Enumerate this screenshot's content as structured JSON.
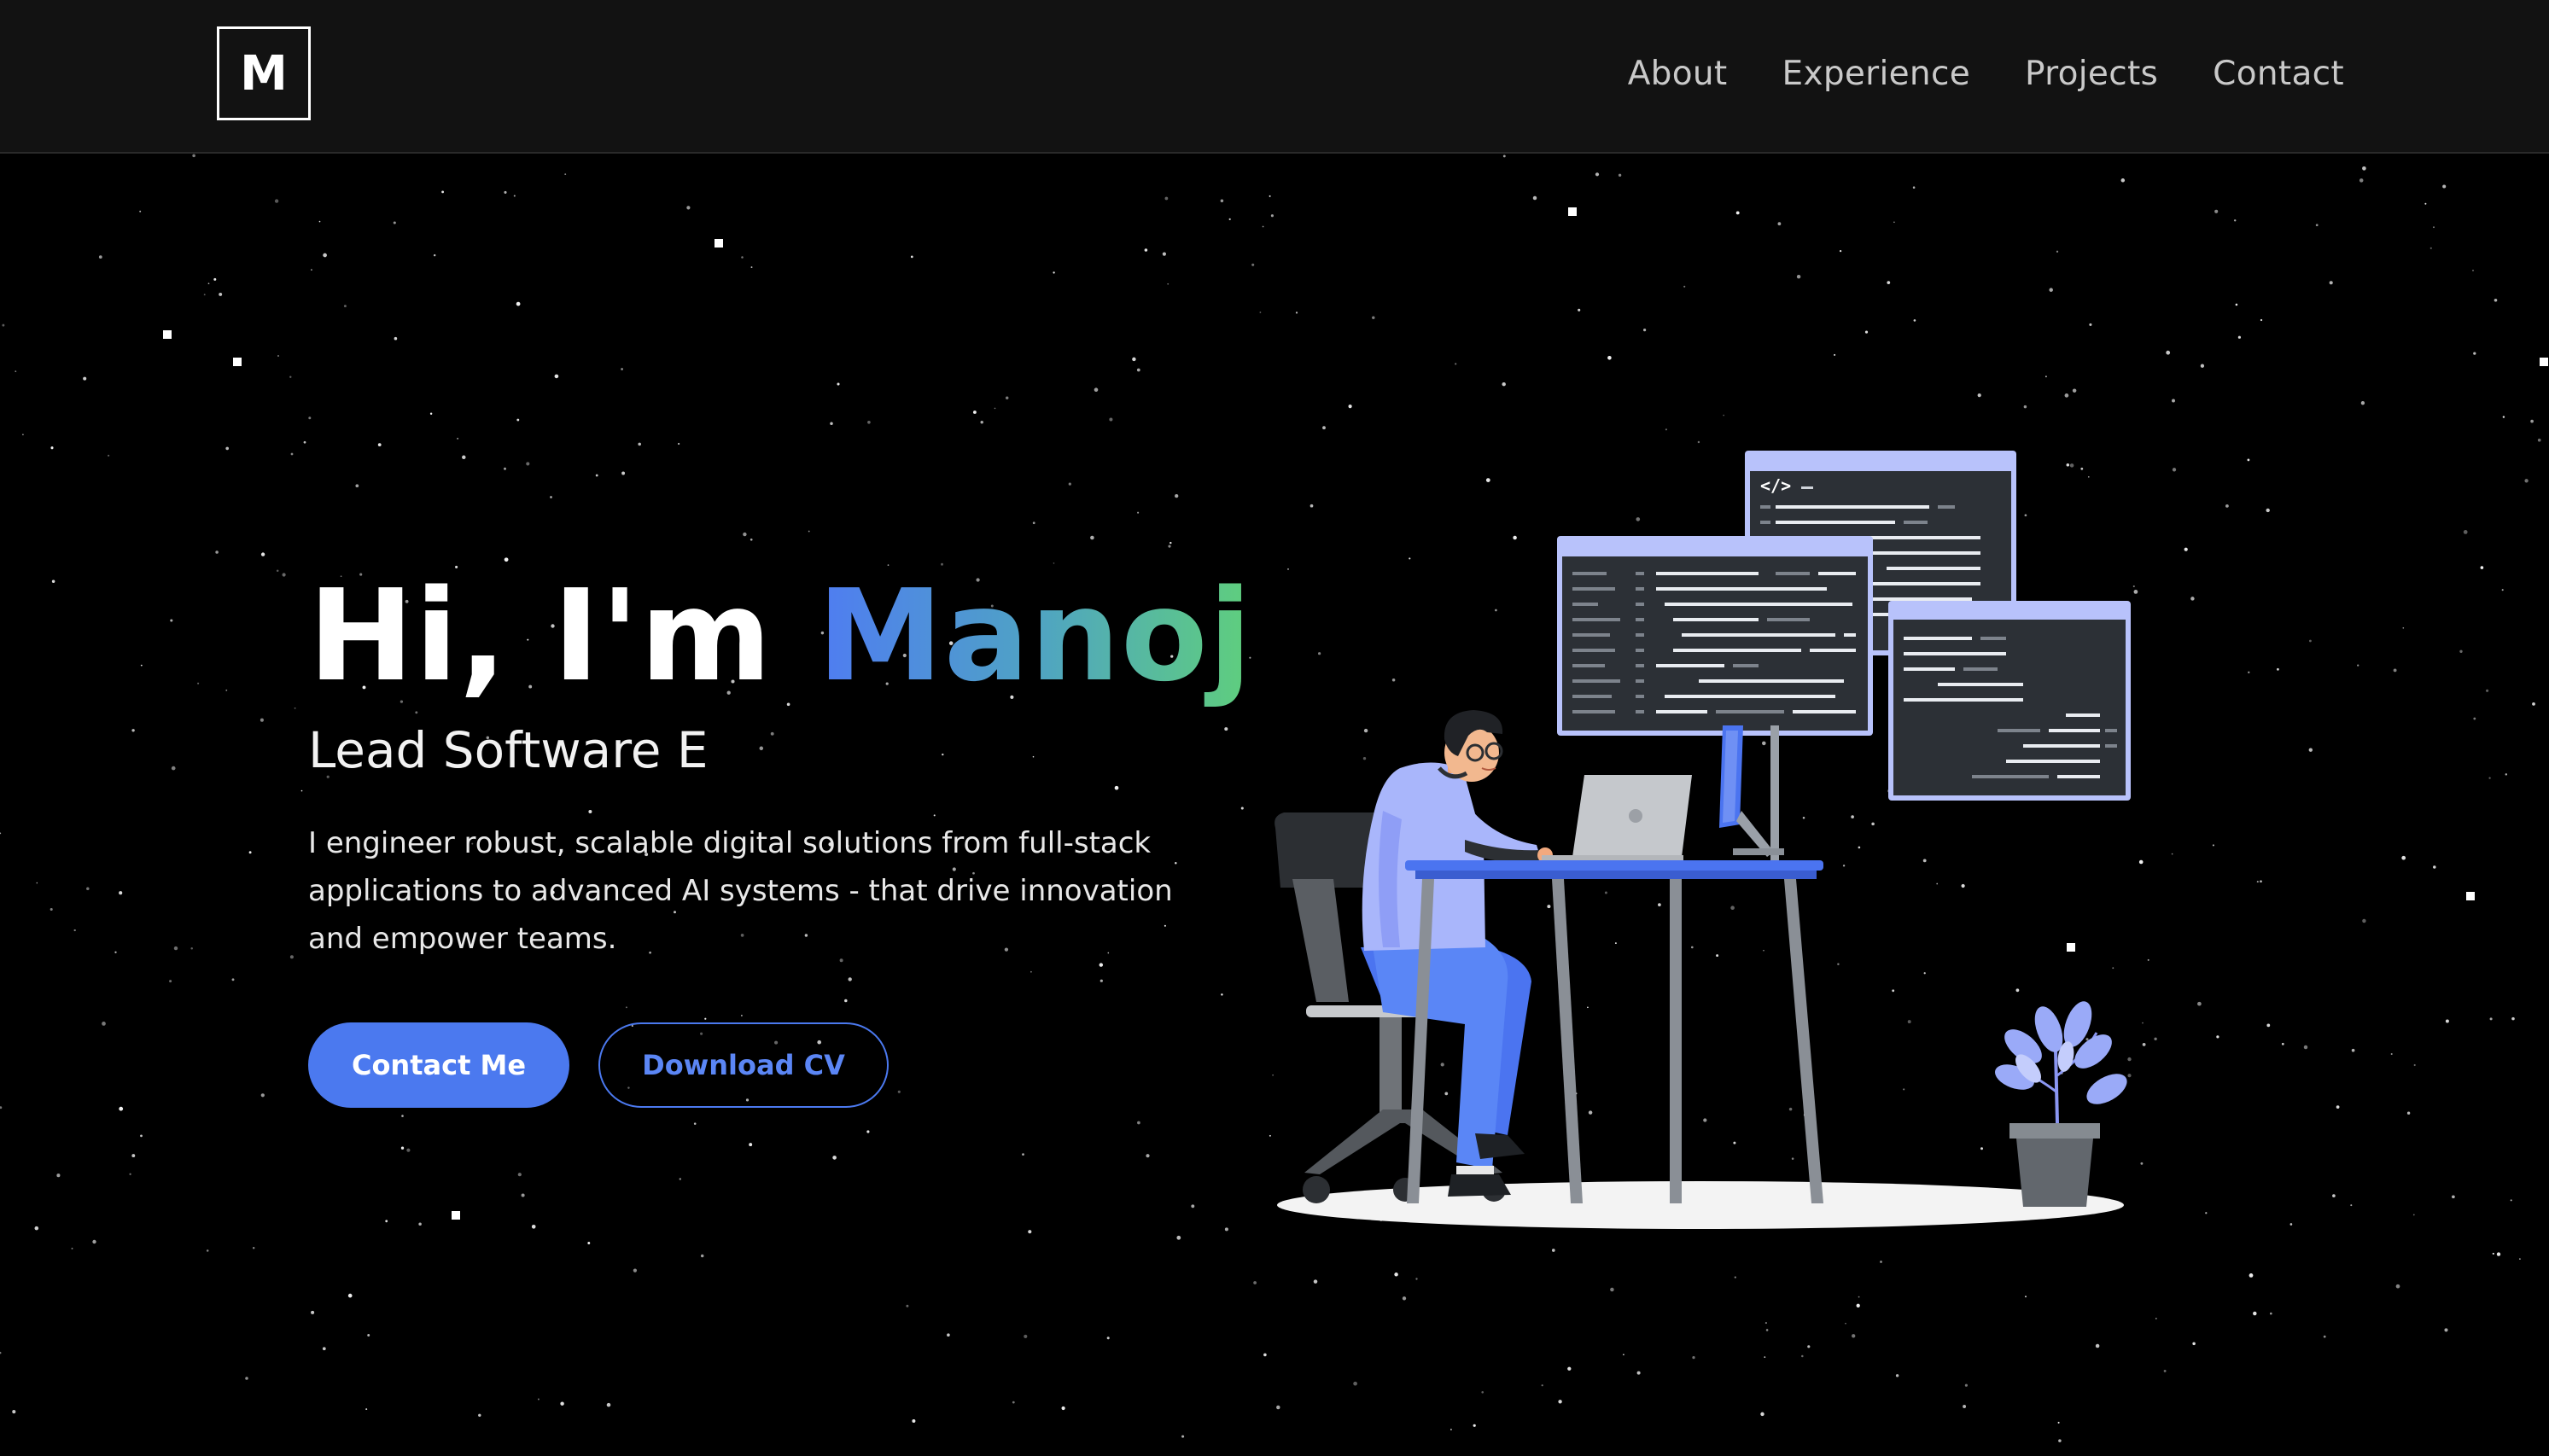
{
  "logo": {
    "text": "M"
  },
  "nav": {
    "items": [
      "About",
      "Experience",
      "Projects",
      "Contact"
    ]
  },
  "hero": {
    "greeting": "Hi, I'm ",
    "name": "Manoj",
    "role": "Lead Software E",
    "description": "I engineer robust, scalable digital solutions from full-stack applications to advanced AI systems - that drive innovation and empower teams.",
    "primary_button": "Contact Me",
    "secondary_button": "Download CV"
  },
  "illustration": {
    "code_tag": "</>"
  },
  "colors": {
    "background": "#000000",
    "navbar": "#121212",
    "accent_blue": "#4b79ef",
    "gradient_start": "#4f7cf2",
    "gradient_end": "#5fcf7c",
    "illustration_lavender": "#b8c2fb",
    "screen_dark": "#2c3036"
  },
  "icons": {
    "logo": "monogram-m-logo",
    "illustration": "developer-at-desk-illustration"
  }
}
